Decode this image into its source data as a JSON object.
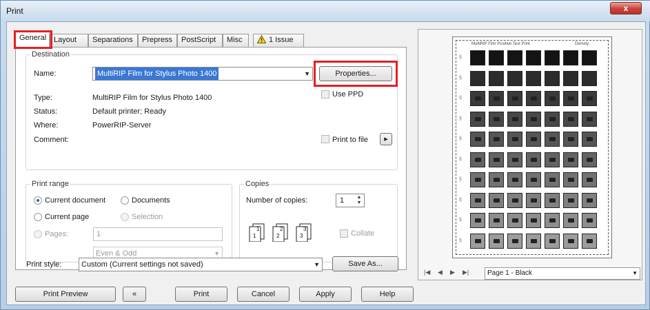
{
  "window": {
    "title": "Print",
    "close_glyph": "x"
  },
  "tabs": [
    {
      "label": "General",
      "active": true
    },
    {
      "label": "Layout"
    },
    {
      "label": "Separations"
    },
    {
      "label": "Prepress"
    },
    {
      "label": "PostScript"
    },
    {
      "label": "Misc"
    },
    {
      "label": "1 Issue",
      "icon": "warning-icon"
    }
  ],
  "destination": {
    "group_label": "Destination",
    "name_label": "Name:",
    "name_value": "MultiRIP Film for Stylus Photo 1400",
    "properties_label": "Properties...",
    "use_ppd_label": "Use PPD",
    "type_label": "Type:",
    "type_value": "MultiRIP Film for Stylus Photo 1400",
    "status_label": "Status:",
    "status_value": "Default printer; Ready",
    "where_label": "Where:",
    "where_value": "PowerRIP-Server",
    "comment_label": "Comment:",
    "print_to_file_label": "Print to file",
    "print_to_file_arrow": "▸"
  },
  "print_range": {
    "group_label": "Print range",
    "current_document": "Current document",
    "documents": "Documents",
    "current_page": "Current page",
    "selection": "Selection",
    "pages": "Pages:",
    "pages_value": "1",
    "subset_value": "Even & Odd"
  },
  "copies": {
    "group_label": "Copies",
    "number_label": "Number of copies:",
    "number_value": "1",
    "collate_label": "Collate",
    "collate_icons": [
      "1",
      "1",
      "2",
      "2",
      "3",
      "3"
    ]
  },
  "print_style": {
    "label": "Print style:",
    "value": "Custom (Current settings not saved)",
    "save_as_label": "Save As..."
  },
  "footer": {
    "print_preview": "Print Preview",
    "collapse_icon": "«",
    "print": "Print",
    "cancel": "Cancel",
    "apply": "Apply",
    "help": "Help"
  },
  "preview": {
    "header_left": "MultiRIP Film Positive Test Print",
    "header_right": "Density:",
    "page_select": "Page 1 - Black",
    "nav": [
      "|◀",
      "◀",
      "▶",
      "▶|"
    ]
  },
  "colors": {
    "highlight": "#e41e22",
    "selection_blue": "#3a78d4"
  }
}
